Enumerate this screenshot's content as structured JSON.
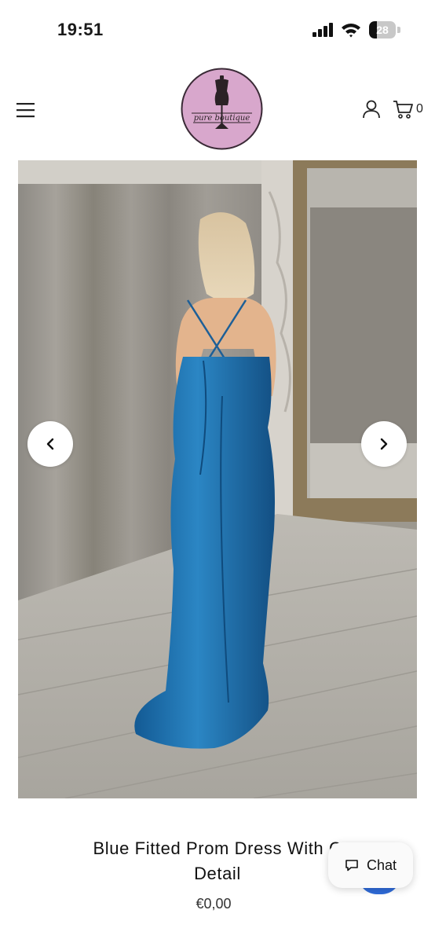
{
  "status_bar": {
    "time": "19:51",
    "battery_level": "28"
  },
  "header": {
    "logo_text": "pure boutique",
    "cart_count": "0"
  },
  "product": {
    "title_line1": "Blue Fitted Prom Dress With C",
    "title_line2": "Detail",
    "price": "€0,00",
    "accent_color": "#1f6fb0"
  },
  "chat": {
    "label": "Chat"
  },
  "icons": {
    "menu": "hamburger-icon",
    "account": "user-icon",
    "cart": "cart-icon",
    "prev": "chevron-left-icon",
    "next": "chevron-right-icon",
    "chat": "speech-bubble-icon"
  }
}
